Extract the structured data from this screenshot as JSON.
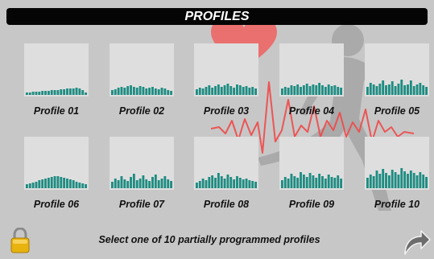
{
  "title": "PROFILES",
  "status_text": "Select one of 10 partially programmed profiles",
  "colors": {
    "bar": "#1e8c82",
    "thumb_bg": "#dedede",
    "title_bar": "#050505",
    "heart": "#f25a5a",
    "ecg": "#f04848"
  },
  "icons": {
    "lock": "padlock-icon",
    "back": "curved-arrow-back-icon"
  },
  "profiles": [
    {
      "label": "Profile 01",
      "levels": [
        3,
        3,
        4,
        4,
        4,
        5,
        5,
        5,
        6,
        6,
        6,
        7,
        7,
        8,
        8,
        8,
        9,
        8,
        6,
        3
      ]
    },
    {
      "label": "Profile 02",
      "levels": [
        6,
        7,
        9,
        10,
        9,
        11,
        12,
        10,
        9,
        11,
        10,
        8,
        9,
        10,
        8,
        7,
        9,
        8,
        6,
        5
      ]
    },
    {
      "label": "Profile 03",
      "levels": [
        7,
        9,
        8,
        10,
        12,
        9,
        11,
        13,
        10,
        12,
        14,
        11,
        9,
        13,
        12,
        10,
        11,
        9,
        10,
        8
      ]
    },
    {
      "label": "Profile 04",
      "levels": [
        8,
        10,
        9,
        12,
        11,
        13,
        10,
        12,
        14,
        11,
        13,
        12,
        15,
        12,
        10,
        13,
        11,
        12,
        10,
        9
      ]
    },
    {
      "label": "Profile 05",
      "levels": [
        10,
        15,
        13,
        11,
        14,
        18,
        12,
        13,
        17,
        11,
        14,
        19,
        12,
        13,
        18,
        11,
        13,
        15,
        12,
        10
      ]
    },
    {
      "label": "Profile 06",
      "levels": [
        5,
        6,
        7,
        8,
        10,
        11,
        12,
        13,
        14,
        15,
        15,
        14,
        13,
        12,
        11,
        10,
        8,
        7,
        6,
        5
      ]
    },
    {
      "label": "Profile 07",
      "levels": [
        8,
        12,
        10,
        15,
        11,
        9,
        14,
        18,
        10,
        12,
        16,
        11,
        9,
        14,
        17,
        10,
        12,
        15,
        11,
        9
      ]
    },
    {
      "label": "Profile 08",
      "levels": [
        7,
        9,
        12,
        10,
        14,
        16,
        13,
        19,
        15,
        12,
        17,
        14,
        11,
        15,
        13,
        11,
        12,
        10,
        9,
        8
      ]
    },
    {
      "label": "Profile 09",
      "levels": [
        10,
        14,
        12,
        18,
        15,
        13,
        20,
        17,
        14,
        19,
        16,
        13,
        18,
        15,
        12,
        17,
        14,
        13,
        16,
        12
      ]
    },
    {
      "label": "Profile 10",
      "levels": [
        13,
        17,
        15,
        22,
        18,
        24,
        19,
        16,
        23,
        20,
        17,
        25,
        21,
        18,
        22,
        19,
        16,
        20,
        17,
        14
      ]
    }
  ]
}
